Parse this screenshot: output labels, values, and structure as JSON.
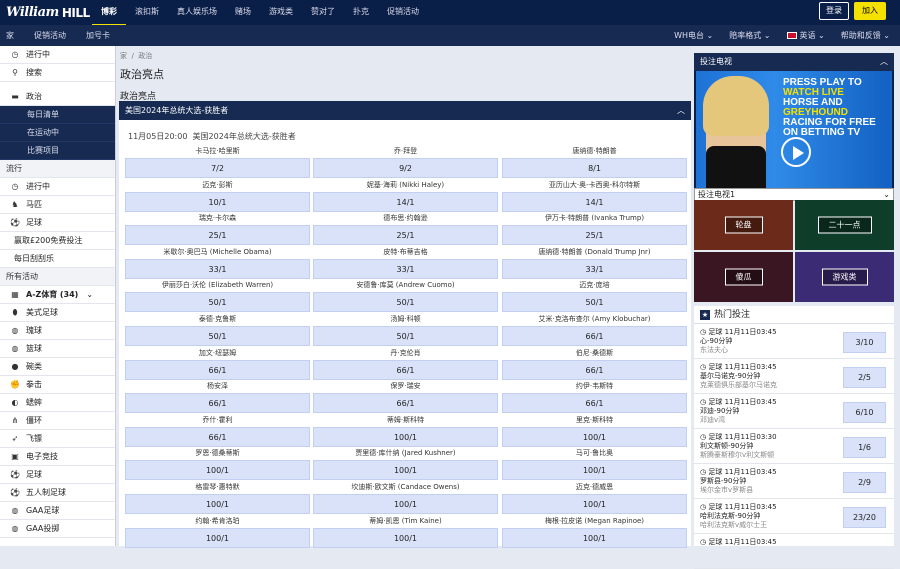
{
  "brand": {
    "logo_script": "William",
    "logo_block": "HILL"
  },
  "topnav": [
    "博彩",
    "滚扣斯",
    "真人娱乐场",
    "赌场",
    "游戏类",
    "赞对了",
    "扑克",
    "促销活动"
  ],
  "auth": {
    "login": "登录",
    "join": "加入"
  },
  "subnav": [
    "家",
    "促销活动",
    "加号卡"
  ],
  "subnav_right": {
    "radio": "WH电台 ⌄",
    "odds": "赔率格式 ⌄",
    "lang": "英语 ⌄",
    "help": "帮助和反馈 ⌄"
  },
  "left": {
    "top_items": [
      {
        "icon": "clock-icon",
        "label": "进行中"
      },
      {
        "icon": "search-icon",
        "label": "搜索"
      }
    ],
    "politics": "政治",
    "politics_sub": [
      "每日清单",
      "在运动中",
      "比赛项目"
    ],
    "popular_header": "流行",
    "popular": [
      {
        "icon": "clock-icon",
        "label": "进行中"
      },
      {
        "icon": "horse-icon",
        "label": "马匹"
      },
      {
        "icon": "football-icon",
        "label": "足球"
      }
    ],
    "promo": "赢取£200免费投注",
    "daily": "每日刮刮乐",
    "all_header": "所有活动",
    "az_label": "A-Z体育",
    "az_count": "(34)",
    "sports": [
      {
        "icon": "american-football-icon",
        "label": "美式足球"
      },
      {
        "icon": "football-icon",
        "label": "瑰球"
      },
      {
        "icon": "basketball-icon",
        "label": "篮球"
      },
      {
        "icon": "bowls-icon",
        "label": "碗类"
      },
      {
        "icon": "boxing-icon",
        "label": "拳击"
      },
      {
        "icon": "cricket-icon",
        "label": "蟋蟀"
      },
      {
        "icon": "darts-icon",
        "label": "僵环"
      },
      {
        "icon": "dart-arrow-icon",
        "label": "飞镖"
      },
      {
        "icon": "esports-icon",
        "label": "电子竞技"
      },
      {
        "icon": "football-icon",
        "label": "足球"
      },
      {
        "icon": "five-a-side-icon",
        "label": "五人制足球"
      },
      {
        "icon": "gaa-icon",
        "label": "GAA足球"
      },
      {
        "icon": "gaa-icon",
        "label": "GAA投掷"
      }
    ]
  },
  "main": {
    "breadcrumb_home": "家",
    "breadcrumb_sep": "/",
    "breadcrumb_current": "政治",
    "title": "政治亮点",
    "subtitle": "政治亮点",
    "market_title": "美国2024年总统大选-获胜者",
    "event_time": "11月05日20:00",
    "event_name": "美国2024年总统大选-获胜者",
    "selections": [
      {
        "name": "卡马拉·哈里斯",
        "odds": "7/2"
      },
      {
        "name": "乔·拜登",
        "odds": "9/2"
      },
      {
        "name": "唐纳德·特朗普",
        "odds": "8/1"
      },
      {
        "name": "迈克·彭斯",
        "odds": "10/1"
      },
      {
        "name": "妮基·海莉 (Nikki Haley)",
        "odds": "14/1"
      },
      {
        "name": "亚历山大·奥-卡西奥-科尔特斯",
        "odds": "14/1"
      },
      {
        "name": "瑞克·卡尔森",
        "odds": "25/1"
      },
      {
        "name": "德布思·约翰逊",
        "odds": "25/1"
      },
      {
        "name": "伊万卡·特朗普 (Ivanka Trump)",
        "odds": "25/1"
      },
      {
        "name": "米歇尔·奥巴马 (Michelle Obama)",
        "odds": "33/1"
      },
      {
        "name": "皮特·布蒂吉格",
        "odds": "33/1"
      },
      {
        "name": "唐纳德·特朗普 (Donald Trump Jnr)",
        "odds": "33/1"
      },
      {
        "name": "伊丽莎白·沃伦 (Elizabeth Warren)",
        "odds": "50/1"
      },
      {
        "name": "安德鲁·库莫 (Andrew Cuomo)",
        "odds": "50/1"
      },
      {
        "name": "迈克·庞培",
        "odds": "50/1"
      },
      {
        "name": "泰德·克鲁斯",
        "odds": "50/1"
      },
      {
        "name": "汤姆·科顿",
        "odds": "50/1"
      },
      {
        "name": "艾米·克洛布查尔 (Amy Klobuchar)",
        "odds": "66/1"
      },
      {
        "name": "加文·纽瑟姆",
        "odds": "66/1"
      },
      {
        "name": "丹·克伦肖",
        "odds": "66/1"
      },
      {
        "name": "伯尼·桑德斯",
        "odds": "66/1"
      },
      {
        "name": "杨安泽",
        "odds": "66/1"
      },
      {
        "name": "保罗·瑞安",
        "odds": "66/1"
      },
      {
        "name": "约伊·韦斯特",
        "odds": "66/1"
      },
      {
        "name": "乔什·霍利",
        "odds": "66/1"
      },
      {
        "name": "蒂姆·斯科特",
        "odds": "100/1"
      },
      {
        "name": "里克·斯科特",
        "odds": "100/1"
      },
      {
        "name": "罗恩·德桑蒂斯",
        "odds": "100/1"
      },
      {
        "name": "贾里德·库什纳 (Jared Kushner)",
        "odds": "100/1"
      },
      {
        "name": "马可·鲁比奥",
        "odds": "100/1"
      },
      {
        "name": "格雷琴·惠特默",
        "odds": "100/1"
      },
      {
        "name": "坎迪斯·欧文斯 (Candace Owens)",
        "odds": "100/1"
      },
      {
        "name": "迈克·德威恩",
        "odds": "100/1"
      },
      {
        "name": "约翰·希肯洛珀",
        "odds": "100/1"
      },
      {
        "name": "蒂姆·凯恩 (Tim Kaine)",
        "odds": "100/1"
      },
      {
        "name": "梅根·拉皮诺 (Megan Rapinoe)",
        "odds": "100/1"
      }
    ]
  },
  "right": {
    "tv_title": "投注电视",
    "tv_banner_line1": "PRESS PLAY TO",
    "tv_banner_line2": "WATCH LIVE",
    "tv_banner_line3": "HORSE AND",
    "tv_banner_line4": "GREYHOUND",
    "tv_banner_line5": "RACING FOR FREE",
    "tv_banner_line6": "ON BETTING TV",
    "tv_select": "投注电视1",
    "games": [
      {
        "label": "轮盘",
        "bg": "#6b2a1a"
      },
      {
        "label": "二十一点",
        "bg": "#0e3d2a"
      },
      {
        "label": "傻瓜",
        "bg": "#3a1522"
      },
      {
        "label": "游戏类",
        "bg": "#3b2a74"
      }
    ],
    "hot_title": "热门投注",
    "hot": [
      {
        "sport": "足球",
        "time": "11月11日03:45",
        "l2": "心-90分钟",
        "l3": "东法夫心",
        "odds": "3/10"
      },
      {
        "sport": "足球",
        "time": "11月11日03:45",
        "l2": "基尔马诺克-90分钟",
        "l3": "克莱德俱乐部基尔马诺克",
        "odds": "2/5"
      },
      {
        "sport": "足球",
        "time": "11月11日03:45",
        "l2": "邓迪-90分钟",
        "l3": "邓迪v湾",
        "odds": "6/10"
      },
      {
        "sport": "足球",
        "time": "11月11日03:30",
        "l2": "利文斯顿-90分钟",
        "l3": "斯腾豪斯穆尔v利文斯顿",
        "odds": "1/6"
      },
      {
        "sport": "足球",
        "time": "11月11日03:45",
        "l2": "罗斯县-90分钟",
        "l3": "埃尔金市v罗斯县",
        "odds": "2/9"
      },
      {
        "sport": "足球",
        "time": "11月11日03:45",
        "l2": "哈利法克斯-90分钟",
        "l3": "哈利法克斯v威尔士王",
        "odds": "23/20"
      },
      {
        "sport": "足球",
        "time": "11月11日03:45",
        "l2": "",
        "l3": "",
        "odds": ""
      }
    ]
  }
}
